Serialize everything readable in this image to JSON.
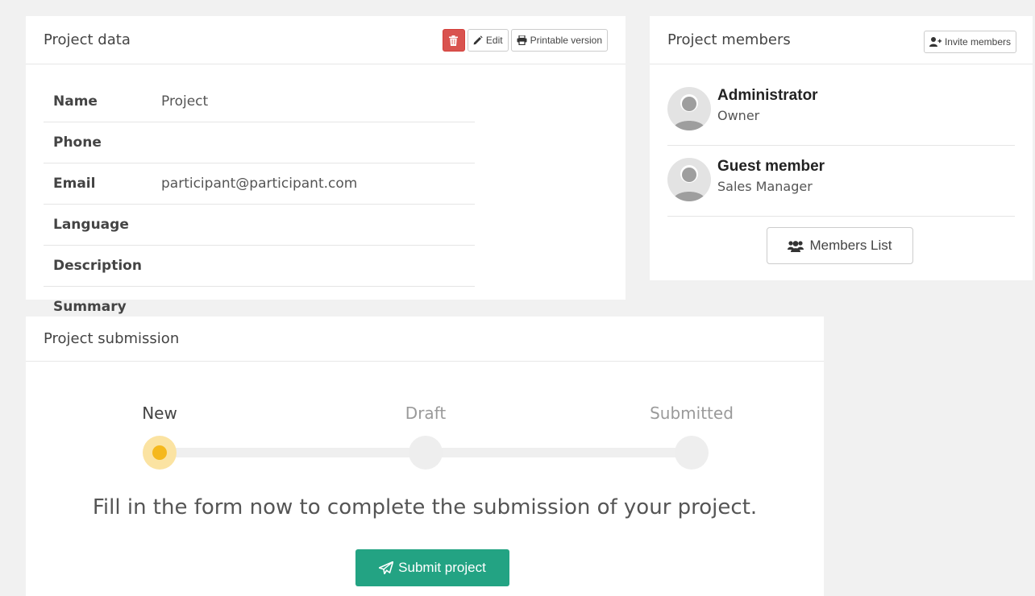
{
  "project_data": {
    "title": "Project data",
    "delete_icon": "trash-icon",
    "edit_label": "Edit",
    "edit_icon": "pencil-icon",
    "print_label": "Printable version",
    "print_icon": "printer-icon",
    "fields": [
      {
        "label": "Name",
        "value": "Project"
      },
      {
        "label": "Phone",
        "value": ""
      },
      {
        "label": "Email",
        "value": "participant@participant.com"
      },
      {
        "label": "Language",
        "value": ""
      },
      {
        "label": "Description",
        "value": ""
      },
      {
        "label": "Summary",
        "value": ""
      }
    ]
  },
  "project_members": {
    "title": "Project members",
    "invite_label": "Invite members",
    "invite_icon": "user-plus-icon",
    "members": [
      {
        "name": "Administrator",
        "role": "Owner",
        "avatar": "user-avatar-icon"
      },
      {
        "name": "Guest member",
        "role": "Sales Manager",
        "avatar": "user-avatar-icon"
      }
    ],
    "members_list_label": "Members List",
    "members_list_icon": "users-icon"
  },
  "project_submission": {
    "title": "Project submission",
    "steps": [
      {
        "label": "New",
        "state": "active"
      },
      {
        "label": "Draft",
        "state": "inactive"
      },
      {
        "label": "Submitted",
        "state": "inactive"
      }
    ],
    "message": "Fill in the form now to complete the submission of your project.",
    "submit_label": "Submit project",
    "submit_icon": "paper-plane-icon",
    "colors": {
      "active_step": "#f5b81c",
      "submit_button": "#23a383"
    }
  },
  "colors": {
    "danger": "#d9534f"
  }
}
